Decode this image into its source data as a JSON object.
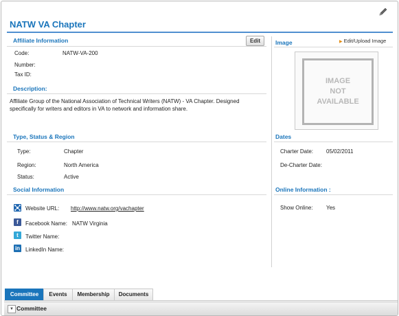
{
  "page": {
    "title": "NATW VA Chapter",
    "edit_icon": "pencil-icon"
  },
  "affiliate": {
    "heading": "Affiliate Information",
    "edit_label": "Edit",
    "code_label": "Code:",
    "code_value": "NATW-VA-200",
    "number_label": "Number:",
    "taxid_label": "Tax ID:"
  },
  "description": {
    "heading": "Description:",
    "text": "Affiliate Group of the National Association of Technical Writers (NATW) - VA Chapter.  Designed specifically for writers and editors in VA to network and information share."
  },
  "image": {
    "heading": "Image",
    "edit_upload_label": "Edit/Upload Image",
    "placeholder_lines": [
      "IMAGE",
      "NOT",
      "AVAILABLE"
    ]
  },
  "type_status_region": {
    "heading": "Type, Status & Region",
    "type_label": "Type:",
    "type_value": "Chapter",
    "region_label": "Region:",
    "region_value": "North America",
    "status_label": "Status:",
    "status_value": "Active"
  },
  "dates": {
    "heading": "Dates",
    "charter_label": "Charter Date:",
    "charter_value": "05/02/2011",
    "decharter_label": "De-Charter Date:"
  },
  "social": {
    "heading": "Social Information",
    "website_label": "Website URL:",
    "website_value": "http://www.natw.org/vachapter",
    "facebook_label": "Facebook Name:",
    "facebook_value": "NATW Virginia",
    "twitter_label": "Twitter Name:",
    "linkedin_label": "LinkedIn Name:",
    "icons": [
      "network-icon",
      "facebook-icon",
      "twitter-icon",
      "linkedin-icon"
    ]
  },
  "online": {
    "heading": "Online Information :",
    "show_online_label": "Show Online:",
    "show_online_value": "Yes"
  },
  "tabs": [
    {
      "label": "Committee",
      "active": true
    },
    {
      "label": "Events",
      "active": false
    },
    {
      "label": "Membership",
      "active": false
    },
    {
      "label": "Documents",
      "active": false
    }
  ],
  "bottom_panel": {
    "label": "Committee",
    "toggle_icon": "collapse-down-icon"
  },
  "colors": {
    "accent": "#1a75bb",
    "title_rule": "#4f8fd0",
    "edit_upload_arrow": "#e38d13"
  }
}
